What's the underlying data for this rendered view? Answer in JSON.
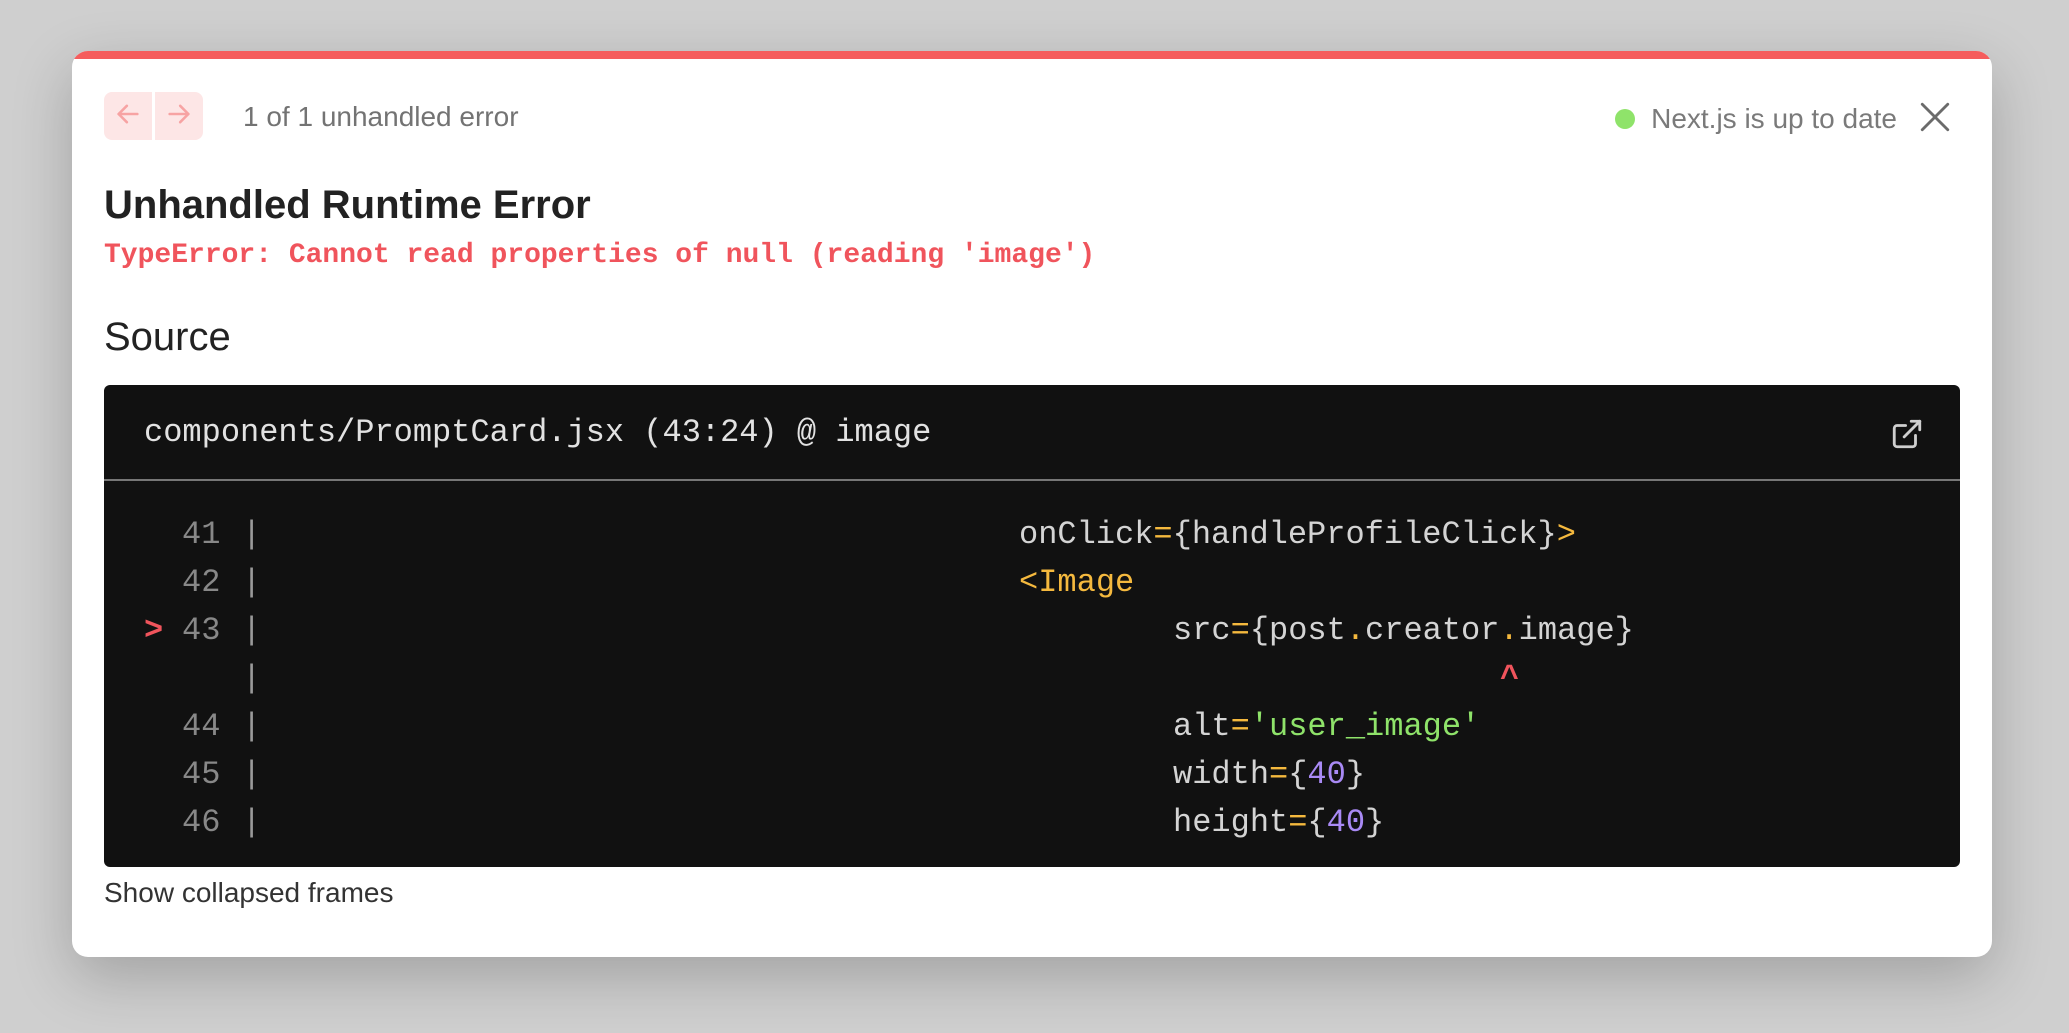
{
  "header": {
    "error_count": "1 of 1 unhandled error",
    "status_text": "Next.js is up to date",
    "status_color": "#8fe36a"
  },
  "error": {
    "title": "Unhandled Runtime Error",
    "message": "TypeError: Cannot read properties of null (reading 'image')"
  },
  "source": {
    "heading": "Source",
    "file_path": "components/PromptCard.jsx (43:24) @ image",
    "lines": [
      {
        "marker": "",
        "number": "41",
        "parts": [
          [
            "onClick",
            ""
          ],
          [
            "=",
            "y"
          ],
          [
            "{handleProfileClick}",
            ""
          ],
          [
            ">",
            "y"
          ]
        ]
      },
      {
        "marker": "",
        "number": "42",
        "parts": [
          [
            "<Image",
            "y"
          ]
        ]
      },
      {
        "marker": ">",
        "number": "43",
        "parts": [
          [
            "src",
            ""
          ],
          [
            "=",
            "y"
          ],
          [
            "{post",
            ""
          ],
          [
            ".",
            "y"
          ],
          [
            "creator",
            ""
          ],
          [
            ".",
            "y"
          ],
          [
            "image}",
            ""
          ]
        ]
      },
      {
        "marker": "",
        "number": "",
        "parts": [
          [
            "^",
            "r"
          ]
        ]
      },
      {
        "marker": "",
        "number": "44",
        "parts": [
          [
            "alt",
            ""
          ],
          [
            "=",
            "y"
          ],
          [
            "'user_image'",
            "g"
          ]
        ]
      },
      {
        "marker": "",
        "number": "45",
        "parts": [
          [
            "width",
            ""
          ],
          [
            "=",
            "y"
          ],
          [
            "{",
            ""
          ],
          [
            "40",
            "p"
          ],
          [
            "}",
            ""
          ]
        ]
      },
      {
        "marker": "",
        "number": "46",
        "parts": [
          [
            "height",
            ""
          ],
          [
            "=",
            "y"
          ],
          [
            "{",
            ""
          ],
          [
            "40",
            "p"
          ],
          [
            "}",
            ""
          ]
        ]
      }
    ]
  },
  "footer": {
    "collapsed_label": "Show collapsed frames"
  },
  "colors": {
    "accent": "#f55d5d",
    "error_text": "#f0545c",
    "code_bg": "#111111",
    "token_operator": "#f5b93e",
    "token_string": "#8fe36a",
    "token_number": "#a98af5"
  }
}
